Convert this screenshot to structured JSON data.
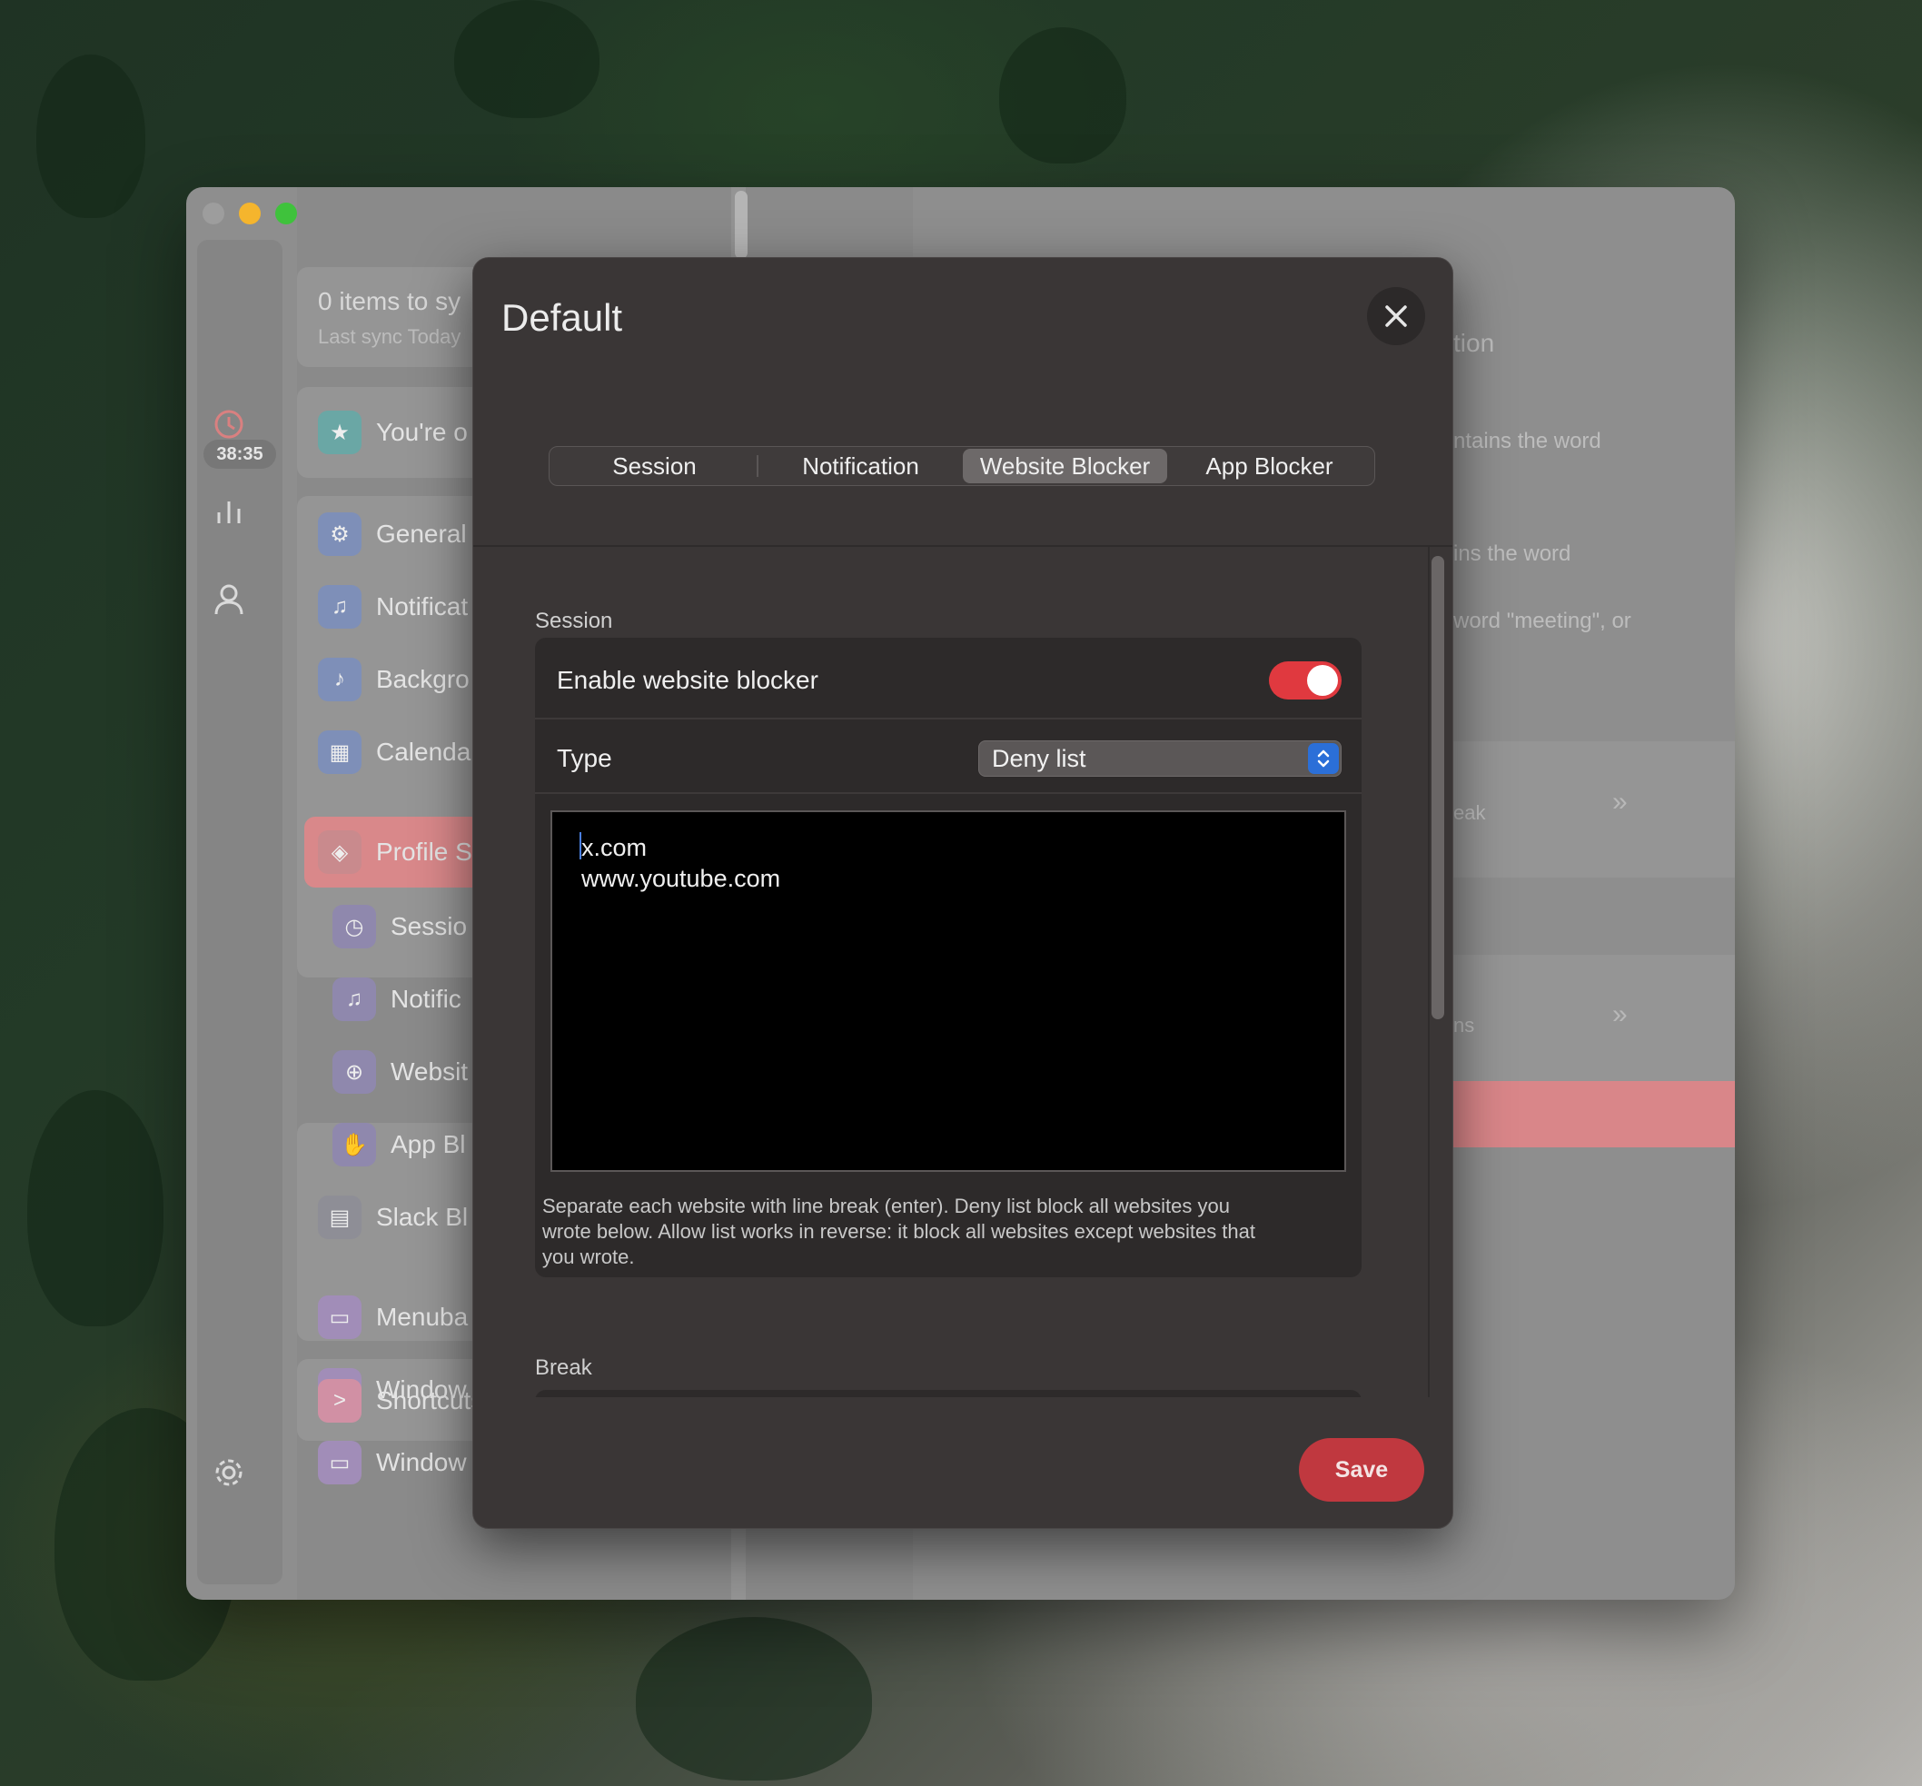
{
  "sidebar": {
    "sync_title": "0 items to sy",
    "sync_sub": "Last sync Today",
    "timer": "38:35",
    "items": [
      {
        "label": "You're o",
        "color": "#6aa7a5",
        "glyph": "★"
      },
      {
        "label": "General",
        "color": "#7e8fb8",
        "glyph": "⚙"
      },
      {
        "label": "Notificat",
        "color": "#7e8fb8",
        "glyph": "🔔"
      },
      {
        "label": "Backgro",
        "color": "#7e8fb8",
        "glyph": "♪"
      },
      {
        "label": "Calenda",
        "color": "#7e8fb8",
        "glyph": "▦"
      },
      {
        "label": "Profile S",
        "color": "#c98a8d",
        "glyph": "◈"
      },
      {
        "label": "Sessio",
        "color": "#8f88ad",
        "glyph": "◷"
      },
      {
        "label": "Notific",
        "color": "#8f88ad",
        "glyph": "🔔"
      },
      {
        "label": "Websit",
        "color": "#8f88ad",
        "glyph": "⊕"
      },
      {
        "label": "App Bl",
        "color": "#8f88ad",
        "glyph": "✋"
      },
      {
        "label": "Slack Bl",
        "color": "#8e8e96",
        "glyph": "▤"
      },
      {
        "label": "Menuba",
        "color": "#a18db8",
        "glyph": "▭"
      },
      {
        "label": "Window",
        "color": "#a18db8",
        "glyph": "▭"
      },
      {
        "label": "Window",
        "color": "#a18db8",
        "glyph": "▭"
      },
      {
        "label": "Shortcuts",
        "color": "#d190a4",
        "glyph": ">"
      }
    ]
  },
  "right_panel": {
    "t1": "tion",
    "t2": "ntains the word",
    "t3": "ins the word",
    "t4": "word \"meeting\", or",
    "t5": "eak",
    "t6": "ns"
  },
  "modal": {
    "title": "Default",
    "tabs": [
      "Session",
      "Notification",
      "Website Blocker",
      "App Blocker"
    ],
    "active_tab": "Website Blocker",
    "session_label": "Session",
    "enable_label": "Enable website blocker",
    "enable_value": true,
    "type_label": "Type",
    "type_value": "Deny list",
    "websites": "x.com\nwww.youtube.com",
    "hint": "Separate each website with line break (enter). Deny list block all websites you wrote below. Allow list works in reverse: it block all websites except websites that you wrote.",
    "break_label": "Break",
    "save_label": "Save"
  },
  "colors": {
    "accent": "#e0393f",
    "save": "#c0383f",
    "select_arrow": "#2b6fd8"
  }
}
